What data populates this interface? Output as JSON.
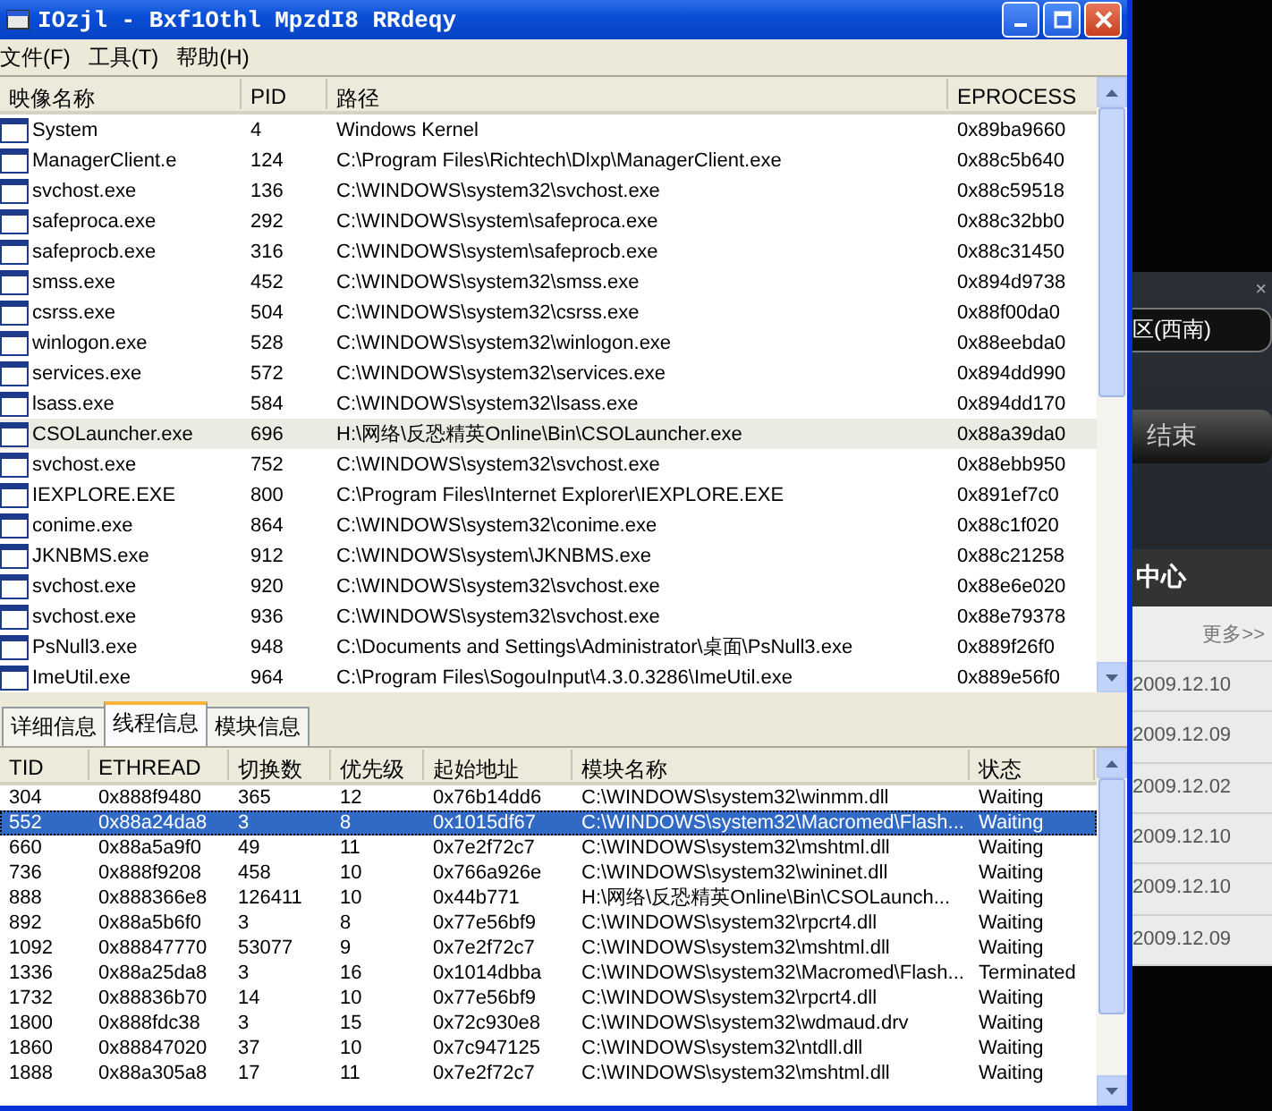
{
  "window": {
    "title": "IOzjl - Bxf1Othl MpzdI8 RRdeqy"
  },
  "menu": [
    "文件(F)",
    "工具(T)",
    "帮助(H)"
  ],
  "process_table": {
    "columns": [
      "映像名称",
      "PID",
      "路径",
      "EPROCESS"
    ],
    "rows": [
      {
        "name": "System",
        "pid": "4",
        "path": "Windows Kernel",
        "eprocess": "0x89ba9660",
        "selected": false
      },
      {
        "name": "ManagerClient.e",
        "pid": "124",
        "path": "C:\\Program Files\\Richtech\\Dlxp\\ManagerClient.exe",
        "eprocess": "0x88c5b640",
        "selected": false
      },
      {
        "name": "svchost.exe",
        "pid": "136",
        "path": "C:\\WINDOWS\\system32\\svchost.exe",
        "eprocess": "0x88c59518",
        "selected": false
      },
      {
        "name": "safeproca.exe",
        "pid": "292",
        "path": "C:\\WINDOWS\\system\\safeproca.exe",
        "eprocess": "0x88c32bb0",
        "selected": false
      },
      {
        "name": "safeprocb.exe",
        "pid": "316",
        "path": "C:\\WINDOWS\\system\\safeprocb.exe",
        "eprocess": "0x88c31450",
        "selected": false
      },
      {
        "name": "smss.exe",
        "pid": "452",
        "path": "C:\\WINDOWS\\system32\\smss.exe",
        "eprocess": "0x894d9738",
        "selected": false
      },
      {
        "name": "csrss.exe",
        "pid": "504",
        "path": "C:\\WINDOWS\\system32\\csrss.exe",
        "eprocess": "0x88f00da0",
        "selected": false
      },
      {
        "name": "winlogon.exe",
        "pid": "528",
        "path": "C:\\WINDOWS\\system32\\winlogon.exe",
        "eprocess": "0x88eebda0",
        "selected": false
      },
      {
        "name": "services.exe",
        "pid": "572",
        "path": "C:\\WINDOWS\\system32\\services.exe",
        "eprocess": "0x894dd990",
        "selected": false
      },
      {
        "name": "lsass.exe",
        "pid": "584",
        "path": "C:\\WINDOWS\\system32\\lsass.exe",
        "eprocess": "0x894dd170",
        "selected": false
      },
      {
        "name": "CSOLauncher.exe",
        "pid": "696",
        "path": "H:\\网络\\反恐精英Online\\Bin\\CSOLauncher.exe",
        "eprocess": "0x88a39da0",
        "selected": true
      },
      {
        "name": "svchost.exe",
        "pid": "752",
        "path": "C:\\WINDOWS\\system32\\svchost.exe",
        "eprocess": "0x88ebb950",
        "selected": false
      },
      {
        "name": "IEXPLORE.EXE",
        "pid": "800",
        "path": "C:\\Program Files\\Internet Explorer\\IEXPLORE.EXE",
        "eprocess": "0x891ef7c0",
        "selected": false
      },
      {
        "name": "conime.exe",
        "pid": "864",
        "path": "C:\\WINDOWS\\system32\\conime.exe",
        "eprocess": "0x88c1f020",
        "selected": false
      },
      {
        "name": "JKNBMS.exe",
        "pid": "912",
        "path": "C:\\WINDOWS\\system\\JKNBMS.exe",
        "eprocess": "0x88c21258",
        "selected": false
      },
      {
        "name": "svchost.exe",
        "pid": "920",
        "path": "C:\\WINDOWS\\system32\\svchost.exe",
        "eprocess": "0x88e6e020",
        "selected": false
      },
      {
        "name": "svchost.exe",
        "pid": "936",
        "path": "C:\\WINDOWS\\system32\\svchost.exe",
        "eprocess": "0x88e79378",
        "selected": false
      },
      {
        "name": "PsNull3.exe",
        "pid": "948",
        "path": "C:\\Documents and Settings\\Administrator\\桌面\\PsNull3.exe",
        "eprocess": "0x889f26f0",
        "selected": false
      },
      {
        "name": "ImeUtil.exe",
        "pid": "964",
        "path": "C:\\Program Files\\SogouInput\\4.3.0.3286\\ImeUtil.exe",
        "eprocess": "0x889e56f0",
        "selected": false
      }
    ]
  },
  "tabs": [
    {
      "label": "详细信息",
      "selected": false
    },
    {
      "label": "线程信息",
      "selected": true
    },
    {
      "label": "模块信息",
      "selected": false
    }
  ],
  "thread_table": {
    "columns": [
      "TID",
      "ETHREAD",
      "切换数",
      "优先级",
      "起始地址",
      "模块名称",
      "状态"
    ],
    "rows": [
      {
        "cells": [
          "304",
          "0x888f9480",
          "365",
          "12",
          "0x76b14dd6",
          "C:\\WINDOWS\\system32\\winmm.dll",
          "Waiting"
        ],
        "selected": false
      },
      {
        "cells": [
          "552",
          "0x88a24da8",
          "3",
          "8",
          "0x1015df67",
          "C:\\WINDOWS\\system32\\Macromed\\Flash...",
          "Waiting"
        ],
        "selected": true
      },
      {
        "cells": [
          "660",
          "0x88a5a9f0",
          "49",
          "11",
          "0x7e2f72c7",
          "C:\\WINDOWS\\system32\\mshtml.dll",
          "Waiting"
        ],
        "selected": false
      },
      {
        "cells": [
          "736",
          "0x888f9208",
          "458",
          "10",
          "0x766a926e",
          "C:\\WINDOWS\\system32\\wininet.dll",
          "Waiting"
        ],
        "selected": false
      },
      {
        "cells": [
          "888",
          "0x888366e8",
          "126411",
          "10",
          "0x44b771",
          "H:\\网络\\反恐精英Online\\Bin\\CSOLaunch...",
          "Waiting"
        ],
        "selected": false
      },
      {
        "cells": [
          "892",
          "0x88a5b6f0",
          "3",
          "8",
          "0x77e56bf9",
          "C:\\WINDOWS\\system32\\rpcrt4.dll",
          "Waiting"
        ],
        "selected": false
      },
      {
        "cells": [
          "1092",
          "0x88847770",
          "53077",
          "9",
          "0x7e2f72c7",
          "C:\\WINDOWS\\system32\\mshtml.dll",
          "Waiting"
        ],
        "selected": false
      },
      {
        "cells": [
          "1336",
          "0x88a25da8",
          "3",
          "16",
          "0x1014dbba",
          "C:\\WINDOWS\\system32\\Macromed\\Flash...",
          "Terminated"
        ],
        "selected": false
      },
      {
        "cells": [
          "1732",
          "0x88836b70",
          "14",
          "10",
          "0x77e56bf9",
          "C:\\WINDOWS\\system32\\rpcrt4.dll",
          "Waiting"
        ],
        "selected": false
      },
      {
        "cells": [
          "1800",
          "0x888fdc38",
          "3",
          "15",
          "0x72c930e8",
          "C:\\WINDOWS\\system32\\wdmaud.drv",
          "Waiting"
        ],
        "selected": false
      },
      {
        "cells": [
          "1860",
          "0x88847020",
          "37",
          "10",
          "0x7c947125",
          "C:\\WINDOWS\\system32\\ntdll.dll",
          "Waiting"
        ],
        "selected": false
      },
      {
        "cells": [
          "1888",
          "0x88a305a8",
          "17",
          "11",
          "0x7e2f72c7",
          "C:\\WINDOWS\\system32\\mshtml.dll",
          "Waiting"
        ],
        "selected": false
      }
    ]
  },
  "background_app": {
    "close": "×",
    "region_button": "区(西南)",
    "end_button": "结束",
    "center_bar": "中心",
    "more_link": "更多>>",
    "dates": [
      "2009.12.10",
      "2009.12.09",
      "2009.12.02",
      "2009.12.10",
      "2009.12.10",
      "2009.12.09"
    ]
  }
}
